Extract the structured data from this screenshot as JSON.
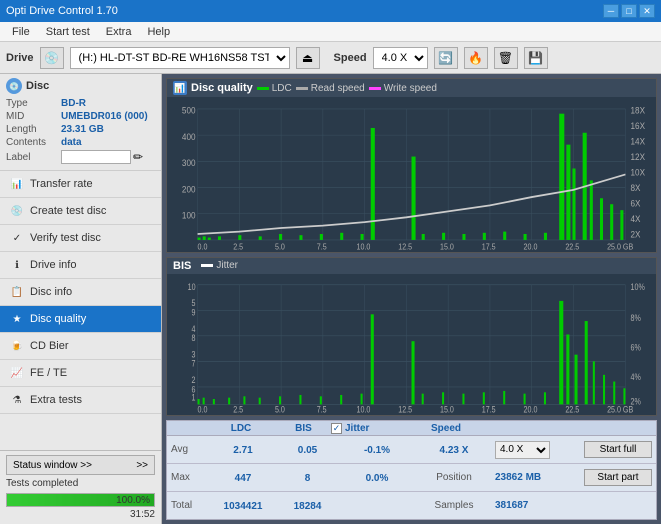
{
  "app": {
    "title": "Opti Drive Control 1.70",
    "title_icon": "💿"
  },
  "title_buttons": {
    "minimize": "─",
    "maximize": "□",
    "close": "✕"
  },
  "menu": {
    "items": [
      "File",
      "Start test",
      "Extra",
      "Help"
    ]
  },
  "toolbar": {
    "drive_label": "Drive",
    "drive_value": "(H:)  HL-DT-ST BD-RE  WH16NS58 TST4",
    "speed_label": "Speed",
    "speed_value": "4.0 X"
  },
  "disc": {
    "section_title": "Disc",
    "type_label": "Type",
    "type_value": "BD-R",
    "mid_label": "MID",
    "mid_value": "UMEBDR016 (000)",
    "length_label": "Length",
    "length_value": "23.31 GB",
    "contents_label": "Contents",
    "contents_value": "data",
    "label_label": "Label",
    "label_value": ""
  },
  "nav": {
    "items": [
      {
        "id": "transfer-rate",
        "label": "Transfer rate",
        "icon": "📊"
      },
      {
        "id": "create-test-disc",
        "label": "Create test disc",
        "icon": "💿"
      },
      {
        "id": "verify-test-disc",
        "label": "Verify test disc",
        "icon": "✓"
      },
      {
        "id": "drive-info",
        "label": "Drive info",
        "icon": "ℹ"
      },
      {
        "id": "disc-info",
        "label": "Disc info",
        "icon": "📋"
      },
      {
        "id": "disc-quality",
        "label": "Disc quality",
        "icon": "★",
        "active": true
      },
      {
        "id": "cd-bier",
        "label": "CD Bier",
        "icon": "🍺"
      },
      {
        "id": "fe-te",
        "label": "FE / TE",
        "icon": "📈"
      },
      {
        "id": "extra-tests",
        "label": "Extra tests",
        "icon": "⚗"
      }
    ]
  },
  "status": {
    "window_btn": "Status window >>",
    "completed_label": "Tests completed",
    "progress": 100,
    "progress_text": "100.0%",
    "time": "31:52"
  },
  "disc_quality_chart": {
    "title": "Disc quality",
    "legends": [
      {
        "label": "LDC",
        "color": "#00cc00"
      },
      {
        "label": "Read speed",
        "color": "#aaaaaa"
      },
      {
        "label": "Write speed",
        "color": "#ff44ff"
      }
    ],
    "y_max": 500,
    "y_labels": [
      "500",
      "400",
      "300",
      "200",
      "100",
      "0"
    ],
    "y_right_labels": [
      "18X",
      "16X",
      "14X",
      "12X",
      "10X",
      "8X",
      "6X",
      "4X",
      "2X"
    ],
    "x_labels": [
      "0.0",
      "2.5",
      "5.0",
      "7.5",
      "10.0",
      "12.5",
      "15.0",
      "17.5",
      "20.0",
      "22.5",
      "25.0 GB"
    ]
  },
  "bis_chart": {
    "title": "BIS",
    "legends": [
      {
        "label": "Jitter",
        "color": "#ffffff"
      }
    ],
    "y_left_labels": [
      "10",
      "9",
      "8",
      "7",
      "6",
      "5",
      "4",
      "3",
      "2",
      "1"
    ],
    "y_right_labels": [
      "10%",
      "8%",
      "6%",
      "4%",
      "2%"
    ],
    "x_labels": [
      "0.0",
      "2.5",
      "5.0",
      "7.5",
      "10.0",
      "12.5",
      "15.0",
      "17.5",
      "20.0",
      "22.5",
      "25.0 GB"
    ]
  },
  "stats": {
    "headers": {
      "ldc": "LDC",
      "bis": "BIS",
      "jitter": "Jitter",
      "speed": "Speed",
      "position": "Position",
      "samples": "Samples"
    },
    "rows": {
      "avg": {
        "label": "Avg",
        "ldc": "2.71",
        "bis": "0.05",
        "jitter": "-0.1%"
      },
      "max": {
        "label": "Max",
        "ldc": "447",
        "bis": "8",
        "jitter": "0.0%"
      },
      "total": {
        "label": "Total",
        "ldc": "1034421",
        "bis": "18284"
      }
    },
    "speed_val": "4.23 X",
    "speed_select": "4.0 X",
    "position_val": "23862 MB",
    "samples_val": "381687",
    "start_full": "Start full",
    "start_part": "Start part",
    "jitter_checked": true
  }
}
